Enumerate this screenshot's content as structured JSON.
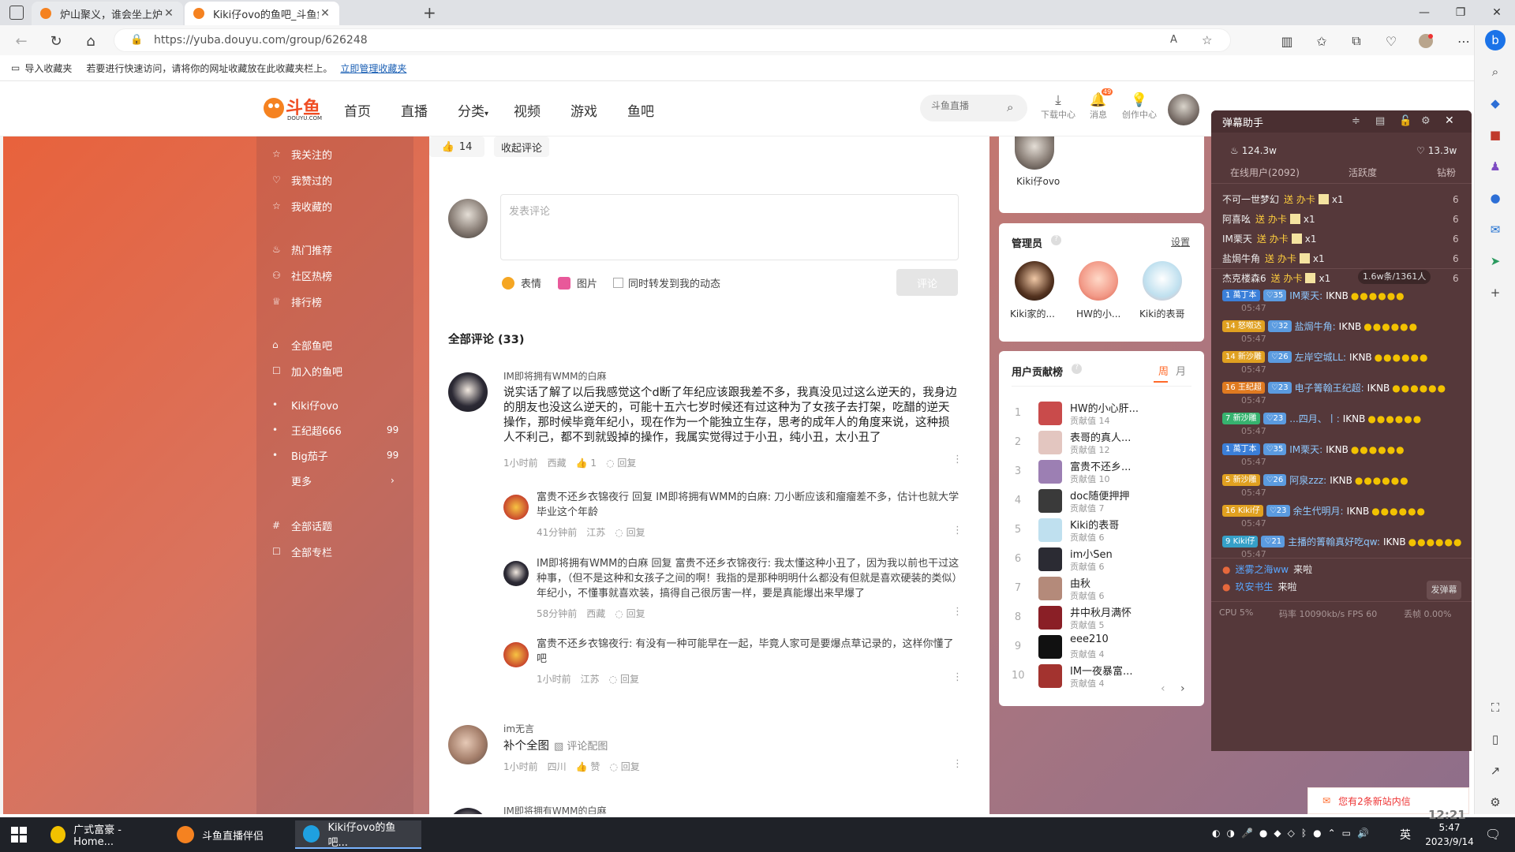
{
  "browser": {
    "tabs": [
      {
        "title": "炉山聚义，谁会坐上炉山头把交椅",
        "active": false
      },
      {
        "title": "Kiki仔ovo的鱼吧_斗鱼鱼吧",
        "active": true
      }
    ],
    "new_tab": "+",
    "url": "https://yuba.douyu.com/group/626248",
    "favbar": {
      "import": "导入收藏夹",
      "hint": "若要进行快速访问，请将你的网址收藏放在此收藏夹栏上。",
      "manage_link": "立即管理收藏夹"
    }
  },
  "site": {
    "logo_text": "斗鱼",
    "logo_sub": "DOUYU.COM",
    "nav": [
      "首页",
      "直播",
      "分类",
      "视频",
      "游戏",
      "鱼吧"
    ],
    "search_placeholder": "斗鱼直播",
    "header_icons": [
      {
        "name": "download-icon",
        "label": "下载中心"
      },
      {
        "name": "message-icon",
        "label": "消息",
        "badge": "49"
      },
      {
        "name": "creator-icon",
        "label": "创作中心"
      }
    ]
  },
  "leftnav": {
    "items": [
      {
        "icon": "☆",
        "label": "我关注的"
      },
      {
        "icon": "👍",
        "label": "我赞过的"
      },
      {
        "icon": "☆",
        "label": "我收藏的"
      },
      {
        "icon": "♨",
        "label": "热门推荐"
      },
      {
        "icon": "⚇",
        "label": "社区热榜"
      },
      {
        "icon": "🏆",
        "label": "排行榜"
      },
      {
        "icon": "⌂",
        "label": "全部鱼吧"
      },
      {
        "icon": "☐",
        "label": "加入的鱼吧"
      }
    ],
    "joined": [
      {
        "label": "Kiki仔ovo",
        "count": ""
      },
      {
        "label": "王纪超666",
        "count": "99"
      },
      {
        "label": "Big茄子",
        "count": "99"
      }
    ],
    "more": "更多",
    "bottom": [
      {
        "icon": "#",
        "label": "全部话题"
      },
      {
        "icon": "☐",
        "label": "全部专栏"
      }
    ]
  },
  "post": {
    "likes": "14",
    "collapse_label": "收起评论",
    "comment_placeholder": "发表评论",
    "emoji_label": "表情",
    "image_label": "图片",
    "repost_label": "同时转发到我的动态",
    "submit_label": "评论",
    "all_comments": "全部评论 (33)"
  },
  "comments": [
    {
      "name": "IM即将拥有WMM的白麻",
      "text": "说实话了解了以后我感觉这个d断了年纪应该跟我差不多，我真没见过这么逆天的，我身边的朋友也没这么逆天的，可能十五六七岁时候还有过这种为了女孩子去打架，吃醋的逆天操作，那时候毕竟年纪小，现在作为一个能独立生存，思考的成年人的角度来说，这种损人不利己，都不到就毁掉的操作，我属实觉得过于小丑，纯小丑，太小丑了",
      "time": "1小时前",
      "loc": "西藏",
      "likes": "1",
      "reply": "回复"
    },
    {
      "name": "im无言",
      "text": "补个全图",
      "img_link": "评论配图",
      "time": "1小时前",
      "loc": "四川",
      "likes": "赞",
      "reply": "回复"
    },
    {
      "name": "IM即将拥有WMM的白麻",
      "text": "",
      "time": "",
      "loc": "",
      "likes": "",
      "reply": ""
    }
  ],
  "replies": [
    {
      "text": "富贵不还乡衣锦夜行 回复 IM即将拥有WMM的白麻: 刀小断应该和瘤瘤差不多，估计也就大学毕业这个年龄",
      "time": "41分钟前",
      "loc": "江苏",
      "reply": "回复"
    },
    {
      "text": "IM即将拥有WMM的白麻 回复 富贵不还乡衣锦夜行: 我太懂这种小丑了，因为我以前也干过这种事，（但不是这种和女孩子之间的啊！我指的是那种明明什么都没有但就是喜欢硬装的类似）年纪小，不懂事就喜欢装，搞得自己很厉害一样，要是真能爆出来早爆了",
      "time": "58分钟前",
      "loc": "西藏",
      "reply": "回复"
    },
    {
      "text": "富贵不还乡衣锦夜行: 有没有一种可能早在一起，毕竟人家可是要爆点草记录的，这样你懂了吧",
      "time": "1小时前",
      "loc": "江苏",
      "reply": "回复"
    }
  ],
  "right": {
    "owner": "Kiki仔ovo",
    "admins_title": "管理员",
    "admins_setting": "设置",
    "admins": [
      "Kiki家的...",
      "HW的小...",
      "Kiki的表哥"
    ],
    "contrib_title": "用户贡献榜",
    "tab_week": "周",
    "tab_month": "月",
    "contrib_label": "贡献值",
    "contributors": [
      {
        "rank": "1",
        "name": "HW的小心肝...",
        "value": "14"
      },
      {
        "rank": "2",
        "name": "表哥的真人...",
        "value": "12"
      },
      {
        "rank": "3",
        "name": "富贵不还乡...",
        "value": "10"
      },
      {
        "rank": "4",
        "name": "doc随便押押",
        "value": "7"
      },
      {
        "rank": "5",
        "name": "Kiki的表哥",
        "value": "6"
      },
      {
        "rank": "6",
        "name": "im小Sen",
        "value": "6"
      },
      {
        "rank": "7",
        "name": "由秋",
        "value": "6"
      },
      {
        "rank": "8",
        "name": "井中秋月满怀",
        "value": "5"
      },
      {
        "rank": "9",
        "name": "eee210",
        "value": "4"
      },
      {
        "rank": "10",
        "name": "IM一夜暴富...",
        "value": "4"
      }
    ],
    "prev": "‹",
    "next": "›"
  },
  "danmu": {
    "title": "弹幕助手",
    "heat": "124.3w",
    "fans": "13.3w",
    "tabs": [
      "在线用户(2092)",
      "活跃度",
      "钻粉"
    ],
    "gifts": [
      {
        "user": "不可一世梦幻",
        "action": "送 办卡",
        "count": "x1",
        "n": "6"
      },
      {
        "user": "阿喜吆",
        "action": "送 办卡",
        "count": "x1",
        "n": "6"
      },
      {
        "user": "IM栗天",
        "action": "送 办卡",
        "count": "x1",
        "n": "6"
      },
      {
        "user": "盐焗牛角",
        "action": "送 办卡",
        "count": "x1",
        "n": "6"
      },
      {
        "user": "杰克楼森6",
        "action": "送 办卡",
        "count": "x1",
        "n": "6"
      }
    ],
    "rate": "1.6w条/1361人",
    "messages": [
      {
        "lv": "1",
        "badge": "萬丁本",
        "blv": "35",
        "user": "IM栗天:",
        "text": "IKNB",
        "time": "05:47",
        "color": "#3b7fd9"
      },
      {
        "lv": "14",
        "badge": "怒呶达",
        "blv": "32",
        "user": "盐焗牛角:",
        "text": "IKNB",
        "time": "05:47",
        "color": "#e0a020"
      },
      {
        "lv": "14",
        "badge": "新沙雕",
        "blv": "26",
        "user": "左岸空城LL:",
        "text": "IKNB",
        "time": "05:47",
        "color": "#e0a020"
      },
      {
        "lv": "16",
        "badge": "王纪超",
        "blv": "23",
        "user": "电子箐翰王纪超:",
        "text": "IKNB",
        "time": "05:47",
        "color": "#e07a20"
      },
      {
        "lv": "7",
        "badge": "新沙雕",
        "blv": "23",
        "user": "...四月、丨:",
        "text": "IKNB",
        "time": "05:47",
        "color": "#36b36f"
      },
      {
        "lv": "1",
        "badge": "萬丁本",
        "blv": "35",
        "user": "IM栗天:",
        "text": "IKNB",
        "time": "05:47",
        "color": "#3b7fd9"
      },
      {
        "lv": "5",
        "badge": "新沙雕",
        "blv": "26",
        "user": "阿泉zzz:",
        "text": "IKNB",
        "time": "05:47",
        "color": "#e0a020"
      },
      {
        "lv": "16",
        "badge": "Kiki仔",
        "blv": "23",
        "user": "余生代明月:",
        "text": "IKNB",
        "time": "05:47",
        "color": "#e0a020"
      },
      {
        "lv": "9",
        "badge": "Kiki仔",
        "blv": "21",
        "user": "主播的箐翰真好吃qw:",
        "text": "IKNB",
        "time": "05:47",
        "color": "#36a0c8"
      }
    ],
    "enters": [
      {
        "user": "迷雾之海ww",
        "action": "来啦"
      },
      {
        "user": "玖安书生",
        "action": "来啦"
      }
    ],
    "send_btn": "发弹幕",
    "cpu": "CPU 5%",
    "bitrate": "码率 10090kb/s  FPS 60",
    "drop": "丢帧 0.00%",
    "notice": "您有2条新站内信"
  },
  "taskbar": {
    "apps": [
      {
        "label": "广式富豪 - Home..."
      },
      {
        "label": "斗鱼直播伴侣"
      },
      {
        "label": "Kiki仔ovo的鱼吧..."
      }
    ],
    "ime": "英",
    "time": "5:47",
    "date": "2023/9/14",
    "overlay_time": "12:21"
  }
}
